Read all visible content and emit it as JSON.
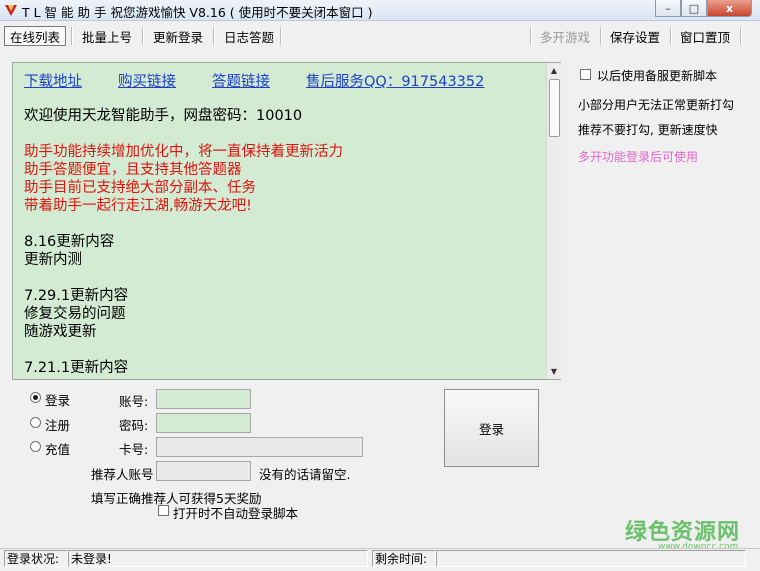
{
  "window": {
    "title": "T L 智 能 助 手 祝您游戏愉快 V8.16 ( 使用时不要关闭本窗口 )",
    "minimize": "–",
    "maximize": "□",
    "close": "x"
  },
  "menu": {
    "items": [
      "在线列表",
      "批量上号",
      "更新登录",
      "日志答题"
    ],
    "right_items": [
      "多开游戏",
      "保存设置",
      "窗口置顶"
    ]
  },
  "info": {
    "links": [
      "下载地址",
      "购买链接",
      "答题链接",
      "售后服务QQ：917543352"
    ],
    "welcome": "欢迎使用天龙智能助手，网盘密码：10010",
    "red_lines": [
      "助手功能持续增加优化中，将一直保持着更新活力",
      "助手答题便宜，且支持其他答题器",
      "助手目前已支持绝大部分副本、任务",
      "带着助手一起行走江湖,畅游天龙吧!"
    ],
    "updates": [
      {
        "title": "8.16更新内容",
        "lines": [
          "更新内测"
        ]
      },
      {
        "title": "7.29.1更新内容",
        "lines": [
          "修复交易的问题",
          "随游戏更新"
        ]
      },
      {
        "title": "7.21.1更新内容",
        "lines": []
      }
    ]
  },
  "right_panel": {
    "checkbox_label": "以后使用备服更新脚本",
    "note1": "小部分用户无法正常更新打勾",
    "note2": "推荐不要打勾, 更新速度快",
    "note3": "多开功能登录后可使用",
    "note3_color": "#e067c8"
  },
  "login": {
    "modes": [
      {
        "label": "登录",
        "selected": true
      },
      {
        "label": "注册",
        "selected": false
      },
      {
        "label": "充值",
        "selected": false
      }
    ],
    "account_label": "账号:",
    "password_label": "密码:",
    "card_label": "卡号:",
    "referrer_label": "推荐人账号",
    "referrer_hint": "没有的话请留空.",
    "reward_note": "填写正确推荐人可获得5天奖励",
    "auto_login_label": "打开时不自动登录脚本",
    "login_button": "登录"
  },
  "status": {
    "login_state_label": "登录状况:",
    "login_state_value": "未登录!",
    "remaining_label": "剩余时间:",
    "remaining_value": ""
  },
  "watermark": {
    "line1": "绿色资源网",
    "line2": "www.downcc.com"
  }
}
